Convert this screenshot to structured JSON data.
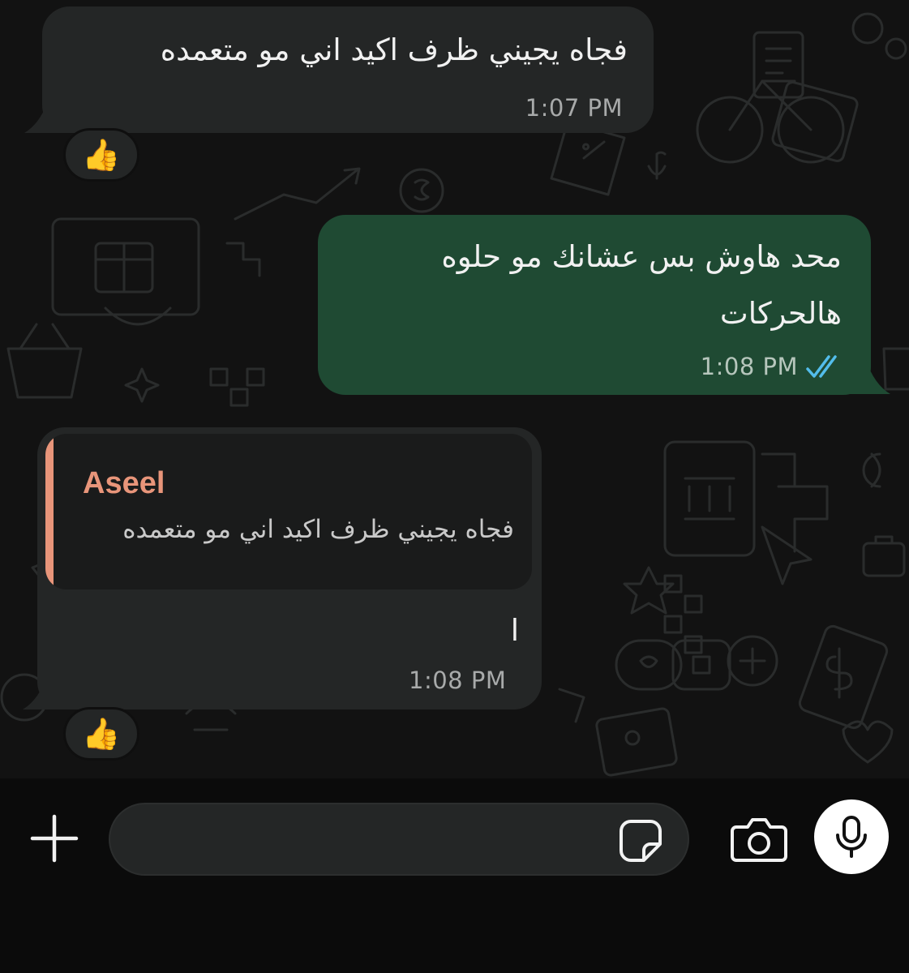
{
  "messages": [
    {
      "direction": "incoming",
      "lines": [
        "فجاه يجيني ظرف اكيد اني مو متعمده"
      ],
      "time": "1:07 PM",
      "reaction": "👍"
    },
    {
      "direction": "outgoing",
      "lines": [
        "محد هاوش بس عشانك مو حلوه",
        "هالحركات"
      ],
      "time": "1:08 PM",
      "status": "read"
    },
    {
      "direction": "incoming",
      "quote": {
        "author": "Aseel",
        "text": "فجاه يجيني ظرف اكيد اني مو متعمده"
      },
      "lines": [
        "ا"
      ],
      "time": "1:08 PM",
      "reaction": "👍"
    }
  ],
  "composer": {
    "placeholder": "",
    "value": ""
  },
  "icons": {
    "add": "plus-icon",
    "sticker": "sticker-icon",
    "camera": "camera-icon",
    "mic": "microphone-icon",
    "read_receipt": "double-check-icon",
    "reaction": "thumbs-up-emoji"
  },
  "colors": {
    "incoming_bubble": "#242626",
    "outgoing_bubble": "#1f4a33",
    "quote_accent": "#e8957a",
    "read_tick": "#53bdeb"
  }
}
